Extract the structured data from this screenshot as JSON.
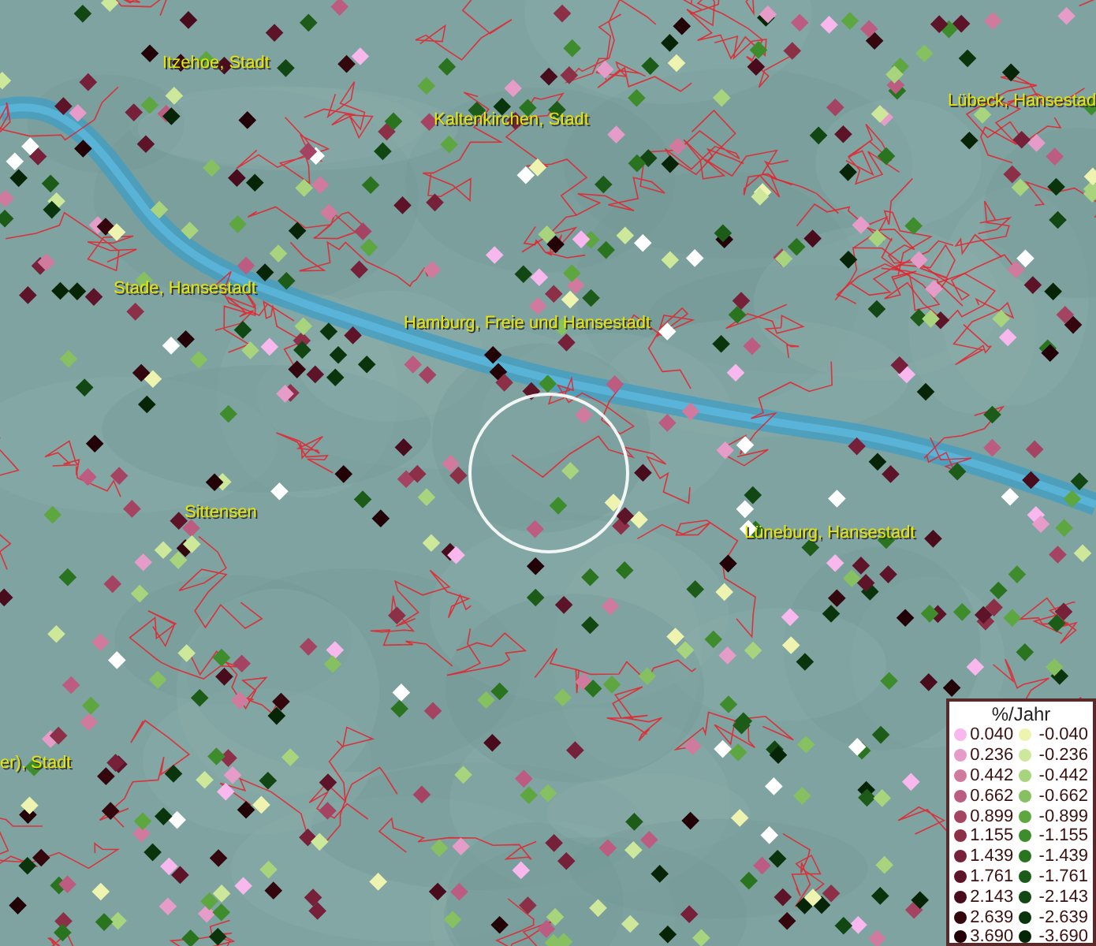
{
  "map": {
    "place_labels": [
      {
        "text": "Itzehoe, Stadt"
      },
      {
        "text": "Kaltenkirchen, Stadt"
      },
      {
        "text": "Lübeck, Hansestad"
      },
      {
        "text": "Stade, Hansestadt"
      },
      {
        "text": "Hamburg, Freie und Hansestadt"
      },
      {
        "text": "Sittensen"
      },
      {
        "text": "Lüneburg, Hansestadt"
      },
      {
        "text": "er), Stadt"
      }
    ]
  },
  "legend": {
    "title": "%/Jahr",
    "rows": [
      [
        {
          "value": "0.040",
          "color": "#f8b8ee"
        },
        {
          "value": "-0.040",
          "color": "#eef4b0"
        }
      ],
      [
        {
          "value": "0.236",
          "color": "#e69cc8"
        },
        {
          "value": "-0.236",
          "color": "#cde89a"
        }
      ],
      [
        {
          "value": "0.442",
          "color": "#d07a9e"
        },
        {
          "value": "-0.442",
          "color": "#a8d47e"
        }
      ],
      [
        {
          "value": "0.662",
          "color": "#bc5c80"
        },
        {
          "value": "-0.662",
          "color": "#86c060"
        }
      ],
      [
        {
          "value": "0.899",
          "color": "#a44462"
        },
        {
          "value": "-0.899",
          "color": "#5ea640"
        }
      ],
      [
        {
          "value": "1.155",
          "color": "#8c3048"
        },
        {
          "value": "-1.155",
          "color": "#3e8c2c"
        }
      ],
      [
        {
          "value": "1.439",
          "color": "#76203a"
        },
        {
          "value": "-1.439",
          "color": "#2a7420"
        }
      ],
      [
        {
          "value": "1.761",
          "color": "#5e1428"
        },
        {
          "value": "-1.761",
          "color": "#1c5c18"
        }
      ],
      [
        {
          "value": "2.143",
          "color": "#480c1c"
        },
        {
          "value": "-2.143",
          "color": "#124612"
        }
      ],
      [
        {
          "value": "2.639",
          "color": "#34060e"
        },
        {
          "value": "-2.639",
          "color": "#0a340c"
        }
      ],
      [
        {
          "value": "3.690",
          "color": "#220206"
        },
        {
          "value": "-3.690",
          "color": "#062406"
        }
      ]
    ]
  }
}
